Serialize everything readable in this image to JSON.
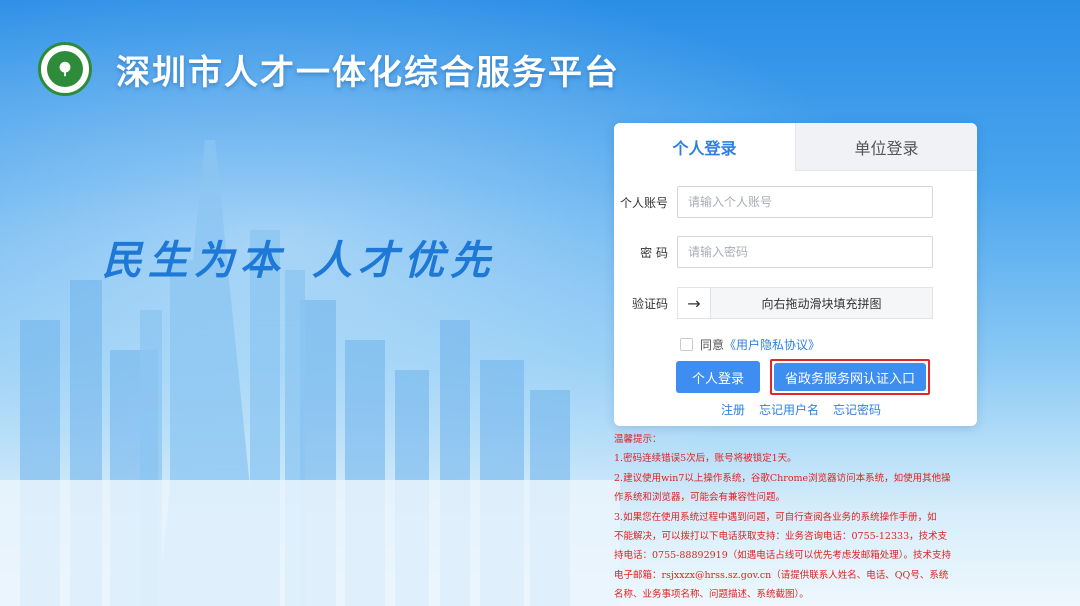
{
  "header": {
    "title": "深圳市人才一体化综合服务平台",
    "logo_icon": "tree-emblem-icon"
  },
  "slogan": {
    "part1": "民生为本",
    "part2": "人才优先"
  },
  "login": {
    "tabs": [
      {
        "label": "个人登录",
        "active": true
      },
      {
        "label": "单位登录",
        "active": false
      }
    ],
    "account": {
      "label": "个人账号",
      "placeholder": "请输入个人账号",
      "value": ""
    },
    "password": {
      "label": "密 码",
      "placeholder": "请输入密码",
      "value": ""
    },
    "captcha": {
      "label": "验证码",
      "handle_icon": "arrow-right-icon",
      "hint": "向右拖动滑块填充拼图"
    },
    "agree": {
      "prefix": "同意",
      "link": "《用户隐私协议》",
      "checked": false
    },
    "login_button": "个人登录",
    "gov_button": "省政务服务网认证入口",
    "links": {
      "register": "注册",
      "forgot_username": "忘记用户名",
      "forgot_password": "忘记密码"
    }
  },
  "notice": {
    "title": "温馨提示：",
    "line1": "1.密码连续错误5次后，账号将被锁定1天。",
    "line2a": "2.建议使用win7以上操作系统，谷歌Chrome浏览器访问本系统，如使用其他操",
    "line2b": "作系统和浏览器，可能会有兼容性问题。",
    "line3a": "3.如果您在使用系统过程中遇到问题，可自行查阅各业务的系统操作手册，如",
    "line3b": "不能解决，可以拨打以下电话获取支持：业务咨询电话：0755-12333，技术支",
    "line3c": "持电话：0755-88892919（如遇电话占线可以优先考虑发邮箱处理）。技术支持",
    "line3d": "电子邮箱：rsjxxzx@hrss.sz.gov.cn（请提供联系人姓名、电话、QQ号、系统",
    "line3e": "名称、业务事项名称、问题描述、系统截图）。"
  },
  "colors": {
    "accent": "#3d8ef0",
    "link": "#2f7fe0",
    "notice": "#e0211f",
    "highlight_border": "#e5252a"
  }
}
